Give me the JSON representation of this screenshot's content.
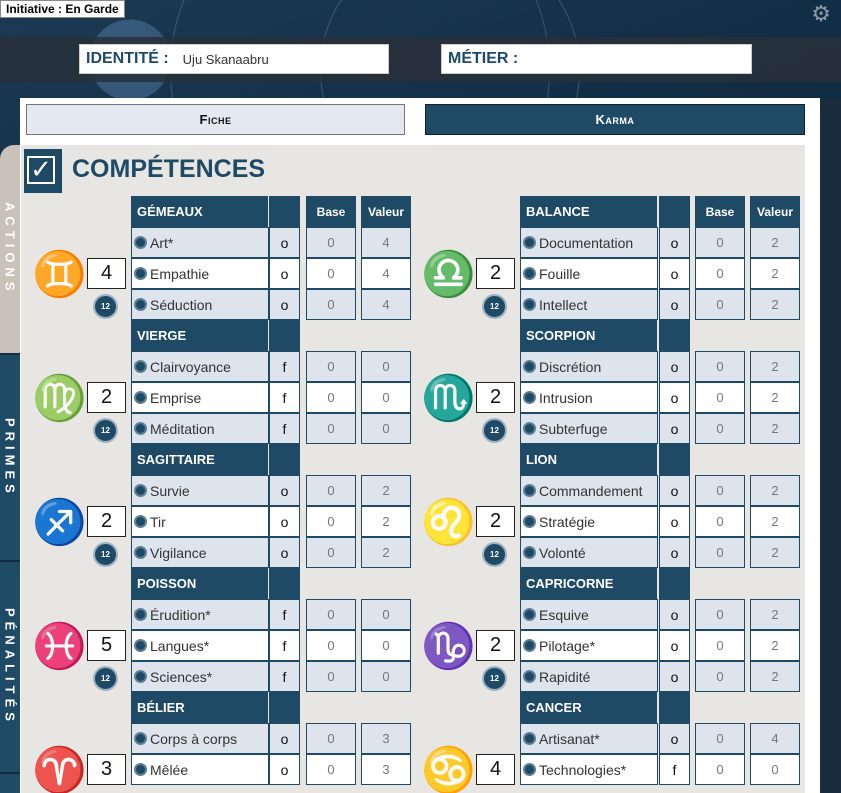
{
  "initiative": "Initiative : En Garde",
  "header": {
    "identite_label": "IDENTITÉ :",
    "identite_value": "Uju Skanaabru",
    "metier_label": "MÉTIER :",
    "metier_value": ""
  },
  "tabs": {
    "fiche": "Fiche",
    "karma": "Karma"
  },
  "side_tabs": {
    "actions": "ACTIONS",
    "primes": "PRIMES",
    "penalites": "PÉNALITÉS"
  },
  "title": "COMPÉTENCES",
  "columns": {
    "base": "Base",
    "valeur": "Valeur"
  },
  "die_label": "12",
  "left_groups": [
    {
      "name": "GÉMEAUX",
      "glyph": "♊",
      "score": "4",
      "skills": [
        {
          "name": "Art*",
          "mode": "o",
          "base": "0",
          "valeur": "4"
        },
        {
          "name": "Empathie",
          "mode": "o",
          "base": "0",
          "valeur": "4"
        },
        {
          "name": "Séduction",
          "mode": "o",
          "base": "0",
          "valeur": "4"
        }
      ]
    },
    {
      "name": "VIERGE",
      "glyph": "♍",
      "score": "2",
      "skills": [
        {
          "name": "Clairvoyance",
          "mode": "f",
          "base": "0",
          "valeur": "0"
        },
        {
          "name": "Emprise",
          "mode": "f",
          "base": "0",
          "valeur": "0"
        },
        {
          "name": "Méditation",
          "mode": "f",
          "base": "0",
          "valeur": "0"
        }
      ]
    },
    {
      "name": "SAGITTAIRE",
      "glyph": "♐",
      "score": "2",
      "skills": [
        {
          "name": "Survie",
          "mode": "o",
          "base": "0",
          "valeur": "2"
        },
        {
          "name": "Tir",
          "mode": "o",
          "base": "0",
          "valeur": "2"
        },
        {
          "name": "Vigilance",
          "mode": "o",
          "base": "0",
          "valeur": "2"
        }
      ]
    },
    {
      "name": "POISSON",
      "glyph": "♓",
      "score": "5",
      "skills": [
        {
          "name": "Érudition*",
          "mode": "f",
          "base": "0",
          "valeur": "0"
        },
        {
          "name": "Langues*",
          "mode": "f",
          "base": "0",
          "valeur": "0"
        },
        {
          "name": "Sciences*",
          "mode": "f",
          "base": "0",
          "valeur": "0"
        }
      ]
    },
    {
      "name": "BÉLIER",
      "glyph": "♈",
      "score": "3",
      "skills": [
        {
          "name": "Corps à corps",
          "mode": "o",
          "base": "0",
          "valeur": "3"
        },
        {
          "name": "Mêlée",
          "mode": "o",
          "base": "0",
          "valeur": "3"
        }
      ]
    }
  ],
  "right_groups": [
    {
      "name": "BALANCE",
      "glyph": "♎",
      "score": "2",
      "skills": [
        {
          "name": "Documentation",
          "mode": "o",
          "base": "0",
          "valeur": "2"
        },
        {
          "name": "Fouille",
          "mode": "o",
          "base": "0",
          "valeur": "2"
        },
        {
          "name": "Intellect",
          "mode": "o",
          "base": "0",
          "valeur": "2"
        }
      ]
    },
    {
      "name": "SCORPION",
      "glyph": "♏",
      "score": "2",
      "skills": [
        {
          "name": "Discrétion",
          "mode": "o",
          "base": "0",
          "valeur": "2"
        },
        {
          "name": "Intrusion",
          "mode": "o",
          "base": "0",
          "valeur": "2"
        },
        {
          "name": "Subterfuge",
          "mode": "o",
          "base": "0",
          "valeur": "2"
        }
      ]
    },
    {
      "name": "LION",
      "glyph": "♌",
      "score": "2",
      "skills": [
        {
          "name": "Commandement",
          "mode": "o",
          "base": "0",
          "valeur": "2"
        },
        {
          "name": "Stratégie",
          "mode": "o",
          "base": "0",
          "valeur": "2"
        },
        {
          "name": "Volonté",
          "mode": "o",
          "base": "0",
          "valeur": "2"
        }
      ]
    },
    {
      "name": "CAPRICORNE",
      "glyph": "♑",
      "score": "2",
      "skills": [
        {
          "name": "Esquive",
          "mode": "o",
          "base": "0",
          "valeur": "2"
        },
        {
          "name": "Pilotage*",
          "mode": "o",
          "base": "0",
          "valeur": "2"
        },
        {
          "name": "Rapidité",
          "mode": "o",
          "base": "0",
          "valeur": "2"
        }
      ]
    },
    {
      "name": "CANCER",
      "glyph": "♋",
      "score": "4",
      "skills": [
        {
          "name": "Artisanat*",
          "mode": "o",
          "base": "0",
          "valeur": "4"
        },
        {
          "name": "Technologies*",
          "mode": "f",
          "base": "0",
          "valeur": "0"
        }
      ]
    }
  ]
}
